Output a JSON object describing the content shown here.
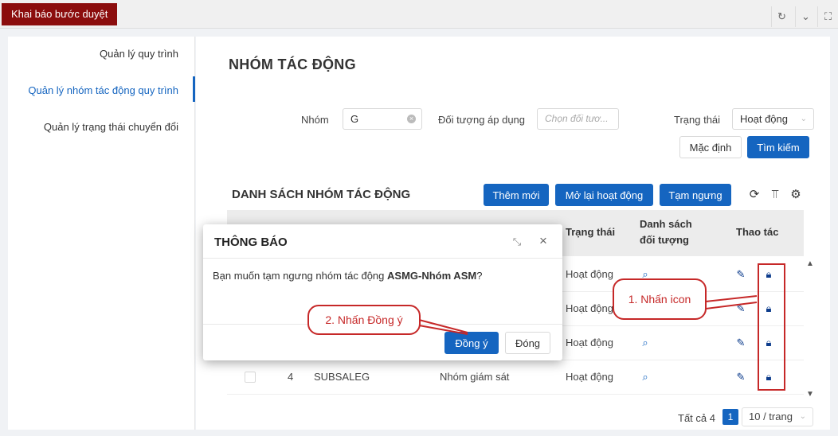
{
  "topbar": {
    "active_tab": "Khai báo bước duyệt",
    "refresh_icon": "refresh-icon",
    "dropdown_icon": "chevron-down-icon",
    "fullscreen_icon": "fullscreen-icon"
  },
  "leftnav": {
    "items": [
      {
        "label": "Quản lý quy trình"
      },
      {
        "label": "Quản lý nhóm tác động quy trình",
        "active": true
      },
      {
        "label": "Quản lý trạng thái chuyển đổi"
      }
    ]
  },
  "page": {
    "title": "NHÓM TÁC ĐỘNG"
  },
  "filters": {
    "group_label": "Nhóm",
    "group_value": "G",
    "object_label": "Đối tượng áp dụng",
    "object_placeholder": "Chọn đối tươ...",
    "status_label": "Trạng thái",
    "status_value": "Hoạt động",
    "default_button": "Mặc định",
    "search_button": "Tìm kiếm"
  },
  "list": {
    "title": "DANH SÁCH NHÓM TÁC ĐỘNG",
    "add_button": "Thêm mới",
    "reopen_button": "Mở lại hoạt động",
    "suspend_button": "Tạm ngưng",
    "columns": {
      "status": "Trạng thái",
      "objects_line1": "Danh sách",
      "objects_line2": "đối tượng",
      "actions": "Thao tác"
    },
    "rows": [
      {
        "status": "Hoạt động"
      },
      {
        "status": "Hoạt động"
      },
      {
        "status": "Hoạt động"
      },
      {
        "index": "4",
        "code": "SUBSALEG",
        "name": "Nhóm giám sát",
        "status": "Hoạt động"
      }
    ]
  },
  "pager": {
    "total": "Tất cả 4",
    "page": "1",
    "page_size": "10 / trang"
  },
  "dialog": {
    "title": "THÔNG BÁO",
    "message_prefix": "Bạn muốn tạm ngưng nhóm tác động ",
    "message_bold": "ASMG-Nhóm ASM",
    "message_suffix": "?",
    "confirm_button": "Đồng ý",
    "close_button": "Đóng"
  },
  "annotations": {
    "step1": "1. Nhấn icon",
    "step2": "2. Nhấn Đồng ý",
    "color": "#c62828"
  }
}
